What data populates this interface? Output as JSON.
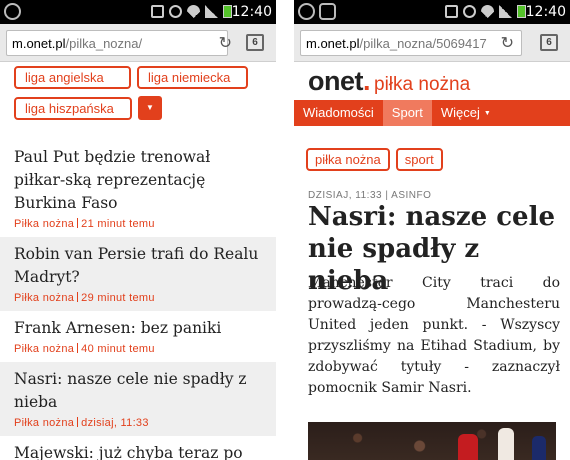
{
  "status_bar": {
    "time": "12:40"
  },
  "left_screen": {
    "url": {
      "domain": "m.onet.pl",
      "path": "/pilka_nozna/"
    },
    "tags_row1": [
      "liga angielska",
      "liga niemiecka"
    ],
    "tags_row2": [
      "liga hiszpańska"
    ],
    "more_label": "▼",
    "articles": [
      {
        "title": "Paul Put będzie trenował piłkar-ską reprezentację Burkina Faso",
        "section": "Piłka nożna",
        "time": "21 minut temu"
      },
      {
        "title": "Robin van Persie trafi do Realu Madryt?",
        "section": "Piłka nożna",
        "time": "29 minut temu"
      },
      {
        "title": "Frank Arnesen: bez paniki",
        "section": "Piłka nożna",
        "time": "40 minut temu"
      },
      {
        "title": "Nasri: nasze cele nie spadły z nieba",
        "section": "Piłka nożna",
        "time": "dzisiaj, 11:33"
      },
      {
        "title": "Majewski: już chyba teraz po",
        "section": "",
        "time": ""
      }
    ]
  },
  "right_screen": {
    "url": {
      "domain": "m.onet.pl",
      "path": "/pilka_nozna/5069417"
    },
    "logo": {
      "text": "onet",
      "dot": "."
    },
    "section_name": "piłka nożna",
    "nav": {
      "item1": "Wiadomości",
      "item2": "Sport",
      "item3": "Więcej",
      "caret": "▼"
    },
    "tags": [
      "piłka nożna",
      "sport"
    ],
    "article": {
      "meta": "DZISIAJ, 11:33 | ASINFO",
      "title": "Nasri: nasze cele nie spadły z nieba",
      "lead": "Manchester City traci do prowadzą-cego Manchesteru United jeden punkt. - Wszyscy przyszliśmy na Etihad Stadium, by zdobywać tytuły - zaznaczył pomocnik Samir Nasri."
    }
  },
  "colors": {
    "accent": "#e2401c",
    "nav_active": "#f07a5e",
    "battery": "#54c22a"
  }
}
